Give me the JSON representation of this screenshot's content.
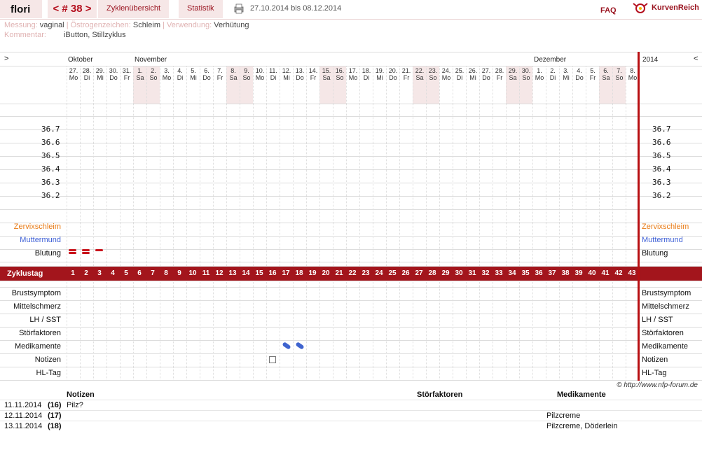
{
  "header": {
    "user": "flori",
    "cycle": "< # 38 >",
    "tabs": [
      "Zyklenübersicht",
      "Statistik"
    ],
    "date_range": "27.10.2014 bis 08.12.2014",
    "faq": "FAQ",
    "brand": "KurvenReich"
  },
  "meta": {
    "messung_label": "Messung:",
    "messung_value": "vaginal",
    "oestrogen_label": "Östrogenzeichen:",
    "oestrogen_value": "Schleim",
    "verwendung_label": "Verwendung:",
    "verwendung_value": "Verhütung",
    "kommentar_label": "Kommentar:",
    "kommentar_value": "iButton, Stillzyklus"
  },
  "chart": {
    "nav_left": ">",
    "nav_right": "<",
    "months": [
      "Oktober",
      "November",
      "Dezember"
    ],
    "year": "2014",
    "days": [
      {
        "d": "27.",
        "w": "Mo"
      },
      {
        "d": "28.",
        "w": "Di"
      },
      {
        "d": "29.",
        "w": "Mi"
      },
      {
        "d": "30.",
        "w": "Do"
      },
      {
        "d": "31.",
        "w": "Fr"
      },
      {
        "d": "1.",
        "w": "Sa",
        "we": true
      },
      {
        "d": "2.",
        "w": "So",
        "we": true
      },
      {
        "d": "3.",
        "w": "Mo"
      },
      {
        "d": "4.",
        "w": "Di"
      },
      {
        "d": "5.",
        "w": "Mi"
      },
      {
        "d": "6.",
        "w": "Do"
      },
      {
        "d": "7.",
        "w": "Fr"
      },
      {
        "d": "8.",
        "w": "Sa",
        "we": true
      },
      {
        "d": "9.",
        "w": "So",
        "we": true
      },
      {
        "d": "10.",
        "w": "Mo"
      },
      {
        "d": "11.",
        "w": "Di"
      },
      {
        "d": "12.",
        "w": "Mi"
      },
      {
        "d": "13.",
        "w": "Do"
      },
      {
        "d": "14.",
        "w": "Fr"
      },
      {
        "d": "15.",
        "w": "Sa",
        "we": true
      },
      {
        "d": "16.",
        "w": "So",
        "we": true
      },
      {
        "d": "17.",
        "w": "Mo"
      },
      {
        "d": "18.",
        "w": "Di"
      },
      {
        "d": "19.",
        "w": "Mi"
      },
      {
        "d": "20.",
        "w": "Do"
      },
      {
        "d": "21.",
        "w": "Fr"
      },
      {
        "d": "22.",
        "w": "Sa",
        "we": true
      },
      {
        "d": "23.",
        "w": "So",
        "we": true
      },
      {
        "d": "24.",
        "w": "Mo"
      },
      {
        "d": "25.",
        "w": "Di"
      },
      {
        "d": "26.",
        "w": "Mi"
      },
      {
        "d": "27.",
        "w": "Do"
      },
      {
        "d": "28.",
        "w": "Fr"
      },
      {
        "d": "29.",
        "w": "Sa",
        "we": true
      },
      {
        "d": "30.",
        "w": "So",
        "we": true
      },
      {
        "d": "1.",
        "w": "Mo"
      },
      {
        "d": "2.",
        "w": "Di"
      },
      {
        "d": "3.",
        "w": "Mi"
      },
      {
        "d": "4.",
        "w": "Do"
      },
      {
        "d": "5.",
        "w": "Fr"
      },
      {
        "d": "6.",
        "w": "Sa",
        "we": true
      },
      {
        "d": "7.",
        "w": "So",
        "we": true
      },
      {
        "d": "8.",
        "w": "Mo"
      }
    ],
    "temps": [
      "36.7",
      "36.6",
      "36.5",
      "36.4",
      "36.3",
      "36.2"
    ],
    "rows_upper": [
      "Zervixschleim",
      "Muttermund",
      "Blutung"
    ],
    "cycle_day_label": "Zyklustag",
    "cycle_days": [
      "1",
      "2",
      "3",
      "4",
      "5",
      "6",
      "7",
      "8",
      "9",
      "10",
      "11",
      "12",
      "13",
      "14",
      "15",
      "16",
      "17",
      "18",
      "19",
      "20",
      "21",
      "22",
      "23",
      "24",
      "25",
      "26",
      "27",
      "28",
      "29",
      "30",
      "31",
      "32",
      "33",
      "34",
      "35",
      "36",
      "37",
      "38",
      "39",
      "40",
      "41",
      "42",
      "43"
    ],
    "rows_lower": [
      "Brustsymptom",
      "Mittelschmerz",
      "LH / SST",
      "Störfaktoren",
      "Medikamente",
      "Notizen",
      "HL-Tag"
    ],
    "bleeding": [
      {
        "day": 1,
        "level": 2
      },
      {
        "day": 2,
        "level": 2
      },
      {
        "day": 3,
        "level": 1
      }
    ],
    "medication_days": [
      17,
      18
    ],
    "note_days": [
      16
    ],
    "colors": {
      "zervix": "#e87a14",
      "muttermund": "#3d5fd6",
      "accent": "#a3151c",
      "bleeding": "#c9141c",
      "pill": "#3f64cf"
    }
  },
  "footer": {
    "copyright": "© http://www.nfp-forum.de",
    "headers": {
      "notizen": "Notizen",
      "stoerfaktoren": "Störfaktoren",
      "medikamente": "Medikamente"
    },
    "rows": [
      {
        "date": "11.11.2014",
        "day": "(16)",
        "note": "Pilz?",
        "med": ""
      },
      {
        "date": "12.11.2014",
        "day": "(17)",
        "note": "",
        "med": "Pilzcreme"
      },
      {
        "date": "13.11.2014",
        "day": "(18)",
        "note": "",
        "med": "Pilzcreme, Döderlein"
      }
    ]
  }
}
